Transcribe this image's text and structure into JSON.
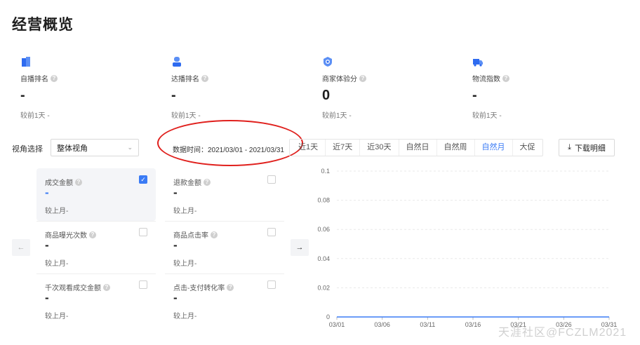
{
  "page": {
    "title": "经营概览"
  },
  "stats": [
    {
      "icon": "store-icon",
      "label": "自播排名",
      "value": "-",
      "compare": "较前1天 -"
    },
    {
      "icon": "person-icon",
      "label": "达播排名",
      "value": "-",
      "compare": "较前1天 -"
    },
    {
      "icon": "shield-star-icon",
      "label": "商家体验分",
      "value": "0",
      "compare": "较前1天 -"
    },
    {
      "icon": "truck-icon",
      "label": "物流指数",
      "value": "-",
      "compare": "较前1天 -"
    }
  ],
  "filters": {
    "view_label": "视角选择",
    "view_selected": "整体视角",
    "date_range": "数据时间：2021/03/01 - 2021/03/31",
    "periods": [
      "近1天",
      "近7天",
      "近30天",
      "自然日",
      "自然周",
      "自然月",
      "大促"
    ],
    "active_period": "自然月",
    "download_label": "下载明细"
  },
  "metrics": [
    {
      "label": "成交金额",
      "value": "-",
      "compare": "较上月-",
      "checked": true
    },
    {
      "label": "退款金额",
      "value": "-",
      "compare": "较上月-",
      "checked": false
    },
    {
      "label": "商品曝光次数",
      "value": "-",
      "compare": "较上月-",
      "checked": false
    },
    {
      "label": "商品点击率",
      "value": "-",
      "compare": "较上月-",
      "checked": false
    },
    {
      "label": "千次观看成交金额",
      "value": "-",
      "compare": "较上月-",
      "checked": false
    },
    {
      "label": "点击-支付转化率",
      "value": "-",
      "compare": "较上月-",
      "checked": false
    }
  ],
  "chart_data": {
    "type": "line",
    "x": [
      "03/01",
      "03/06",
      "03/11",
      "03/16",
      "03/21",
      "03/26",
      "03/31"
    ],
    "y_ticks": [
      "0.1",
      "0.08",
      "0.06",
      "0.04",
      "0.02",
      "0"
    ],
    "ylim": [
      0,
      0.1
    ],
    "series": [
      {
        "values": [
          0,
          0,
          0,
          0,
          0,
          0,
          0
        ]
      }
    ],
    "line_color": "#3a7bf5"
  },
  "colors": {
    "accent": "#3a7bf5",
    "annotation": "#e0201d"
  },
  "watermark": "天涯社区@FCZLM2021"
}
